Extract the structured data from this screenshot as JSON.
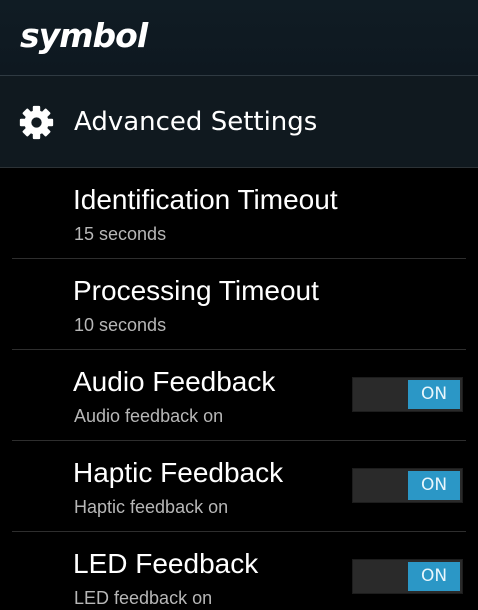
{
  "brand": {
    "logo_text": "symbol"
  },
  "action_bar": {
    "icon": "gear-icon",
    "title": "Advanced Settings"
  },
  "settings": [
    {
      "title": "Identification Timeout",
      "summary": "15 seconds"
    },
    {
      "title": "Processing Timeout",
      "summary": "10 seconds"
    },
    {
      "title": "Audio Feedback",
      "summary": "Audio feedback on",
      "toggle": "ON"
    },
    {
      "title": "Haptic Feedback",
      "summary": "Haptic feedback on",
      "toggle": "ON"
    },
    {
      "title": "LED Feedback",
      "summary": "LED feedback on",
      "toggle": "ON"
    }
  ],
  "colors": {
    "accent": "#2b97c6",
    "background": "#000000",
    "header_background": "#10191f"
  }
}
